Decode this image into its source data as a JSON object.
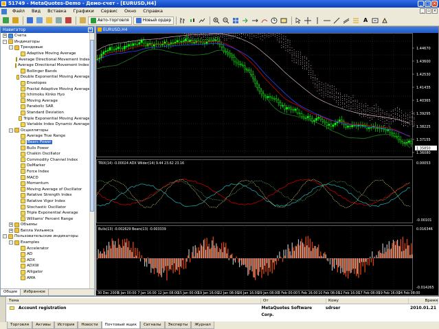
{
  "window": {
    "title": "51749 - MetaQuotes-Demo - Демо-счет - [EURUSD,H4]"
  },
  "menu": [
    "Файл",
    "Вид",
    "Вставка",
    "Графики",
    "Сервис",
    "Окно",
    "Справка"
  ],
  "toolbar": {
    "autotrade_label": "Авто-торговля",
    "neworder_label": "Новый ордер"
  },
  "navigator": {
    "title": "Навигатор",
    "tree": [
      {
        "level": 0,
        "exp": "+",
        "icon": "acc",
        "label": "Счета"
      },
      {
        "level": 0,
        "exp": "-",
        "icon": "folder",
        "label": "Индикаторы"
      },
      {
        "level": 1,
        "exp": "-",
        "icon": "folder",
        "label": "Трендовые"
      },
      {
        "level": 2,
        "exp": "",
        "icon": "ind",
        "label": "Adaptive Moving Average"
      },
      {
        "level": 2,
        "exp": "",
        "icon": "ind",
        "label": "Average Directional Movement Index"
      },
      {
        "level": 2,
        "exp": "",
        "icon": "ind",
        "label": "Average Directional Movement Index Wilder"
      },
      {
        "level": 2,
        "exp": "",
        "icon": "ind",
        "label": "Bollinger Bands"
      },
      {
        "level": 2,
        "exp": "",
        "icon": "ind",
        "label": "Double Exponential Moving Average"
      },
      {
        "level": 2,
        "exp": "",
        "icon": "ind",
        "label": "Envelopes"
      },
      {
        "level": 2,
        "exp": "",
        "icon": "ind",
        "label": "Fractal Adaptive Moving Average"
      },
      {
        "level": 2,
        "exp": "",
        "icon": "ind",
        "label": "Ichimoku Kinko Hyo"
      },
      {
        "level": 2,
        "exp": "",
        "icon": "ind",
        "label": "Moving Average"
      },
      {
        "level": 2,
        "exp": "",
        "icon": "ind",
        "label": "Parabolic SAR"
      },
      {
        "level": 2,
        "exp": "",
        "icon": "ind",
        "label": "Standard Deviation"
      },
      {
        "level": 2,
        "exp": "",
        "icon": "ind",
        "label": "Triple Exponential Moving Average"
      },
      {
        "level": 2,
        "exp": "",
        "icon": "ind",
        "label": "Variable Index Dynamic Average"
      },
      {
        "level": 1,
        "exp": "-",
        "icon": "folder",
        "label": "Осцилляторы"
      },
      {
        "level": 2,
        "exp": "",
        "icon": "ind",
        "label": "Average True Range"
      },
      {
        "level": 2,
        "exp": "",
        "icon": "ind",
        "label": "Bears Power",
        "selected": true
      },
      {
        "level": 2,
        "exp": "",
        "icon": "ind",
        "label": "Bulls Power"
      },
      {
        "level": 2,
        "exp": "",
        "icon": "ind",
        "label": "Chaikin Oscillator"
      },
      {
        "level": 2,
        "exp": "",
        "icon": "ind",
        "label": "Commodity Channel Index"
      },
      {
        "level": 2,
        "exp": "",
        "icon": "ind",
        "label": "DeMarker"
      },
      {
        "level": 2,
        "exp": "",
        "icon": "ind",
        "label": "Force Index"
      },
      {
        "level": 2,
        "exp": "",
        "icon": "ind",
        "label": "MACD"
      },
      {
        "level": 2,
        "exp": "",
        "icon": "ind",
        "label": "Momentum"
      },
      {
        "level": 2,
        "exp": "",
        "icon": "ind",
        "label": "Moving Average of Oscillator"
      },
      {
        "level": 2,
        "exp": "",
        "icon": "ind",
        "label": "Relative Strength Index"
      },
      {
        "level": 2,
        "exp": "",
        "icon": "ind",
        "label": "Relative Vigor Index"
      },
      {
        "level": 2,
        "exp": "",
        "icon": "ind",
        "label": "Stochastic Oscillator"
      },
      {
        "level": 2,
        "exp": "",
        "icon": "ind",
        "label": "Triple Exponential Average"
      },
      {
        "level": 2,
        "exp": "",
        "icon": "ind",
        "label": "Williams' Percent Range"
      },
      {
        "level": 1,
        "exp": "+",
        "icon": "folder",
        "label": "Объемы"
      },
      {
        "level": 1,
        "exp": "+",
        "icon": "folder",
        "label": "Билла Уильямса"
      },
      {
        "level": 0,
        "exp": "-",
        "icon": "folder",
        "label": "Пользовательские индикаторы"
      },
      {
        "level": 1,
        "exp": "-",
        "icon": "folder",
        "label": "Examples"
      },
      {
        "level": 2,
        "exp": "",
        "icon": "ind",
        "label": "Accelerator"
      },
      {
        "level": 2,
        "exp": "",
        "icon": "ind",
        "label": "AD"
      },
      {
        "level": 2,
        "exp": "",
        "icon": "ind",
        "label": "ADX"
      },
      {
        "level": 2,
        "exp": "",
        "icon": "ind",
        "label": "ADXW"
      },
      {
        "level": 2,
        "exp": "",
        "icon": "ind",
        "label": "Alligator"
      },
      {
        "level": 2,
        "exp": "",
        "icon": "ind",
        "label": "AMA"
      }
    ],
    "tabs": [
      "Общие",
      "Избранное"
    ]
  },
  "chart": {
    "title": "EURUSD,H4",
    "price_labels": [
      "1.44670",
      "1.43600",
      "1.42530",
      "1.41435",
      "1.40365",
      "1.39295",
      "1.38225",
      "1.37155",
      "1.36080"
    ],
    "current_price": "1.35850",
    "trix_label": "TRIX(14) -0.00024  ADX Wilder(14) 9.44 23.62 23.16",
    "trix_scale": [
      "0.00053",
      "-0.00101"
    ],
    "bb_label": "Bulls(13) -0.002629  Bears(13) -0.003339",
    "bb_scale": [
      "0.016346",
      "-0.014265"
    ],
    "dates": [
      "30 Dec 2009",
      "5 Jan 00:00",
      "7 Jan 16:00",
      "12 Jan 08:00",
      "15 Jan 00:00",
      "19 Jan 16:00",
      "22 Jan 08:00",
      "26 Jan 16:00",
      "29 Jan 08:00",
      "3 Feb 00:00",
      "5 Feb 16:00",
      "10 Feb 08:00",
      "12 Feb 16:00",
      "17 Feb 08:00",
      "19 Feb 16:00",
      "24 Feb 08:00"
    ]
  },
  "terminal": {
    "headers": [
      "Тема",
      "От",
      "Кому",
      "Время"
    ],
    "row": {
      "subject": "Account registration",
      "from": "MetaQuotes Software Corp.",
      "to": "sdrser",
      "time": "2010.01.21"
    },
    "tabs": [
      "Торговля",
      "Активы",
      "История",
      "Новости",
      "Почтовый ящик",
      "Сигналы",
      "Эксперты",
      "Журнал"
    ],
    "active_tab": 4
  }
}
